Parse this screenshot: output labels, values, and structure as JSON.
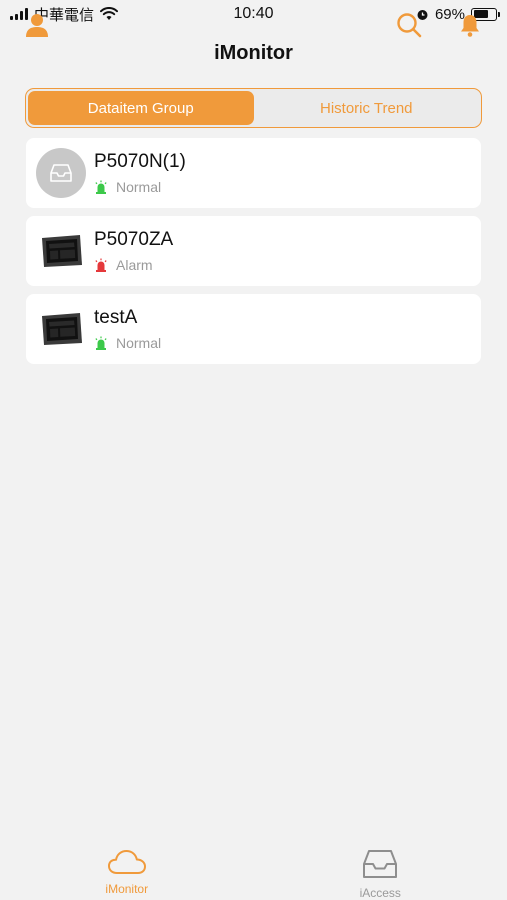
{
  "status_bar": {
    "carrier": "中華電信",
    "time": "10:40",
    "battery": "69%",
    "battery_level": 0.69,
    "icons": [
      "signal-icon",
      "wifi-icon",
      "alarm-clock-icon",
      "battery-icon"
    ]
  },
  "nav": {
    "title": "iMonitor",
    "icons": [
      "user-icon",
      "search-icon",
      "bell-icon"
    ]
  },
  "segments": [
    {
      "label": "Dataitem Group",
      "active": true
    },
    {
      "label": "Historic Trend",
      "active": false
    }
  ],
  "devices": [
    {
      "name": "P5070N(1)",
      "status": "Normal",
      "status_icon": "normal-status-icon",
      "thumbnail": "placeholder-inbox-icon"
    },
    {
      "name": "P5070ZA",
      "status": "Alarm",
      "status_icon": "alarm-status-icon",
      "thumbnail": "hmi-device-icon"
    },
    {
      "name": "testA",
      "status": "Normal",
      "status_icon": "normal-status-icon",
      "thumbnail": "hmi-device-icon"
    }
  ],
  "tabs": [
    {
      "label": "iMonitor",
      "icon": "cloud-icon",
      "active": true
    },
    {
      "label": "iAccess",
      "icon": "inbox-icon",
      "active": false
    }
  ],
  "colors": {
    "accent": "#f09a3b",
    "background": "#f2f2f2",
    "normal": "#3cc94a",
    "alarm": "#e5383b",
    "muted": "#9a9a9a"
  }
}
